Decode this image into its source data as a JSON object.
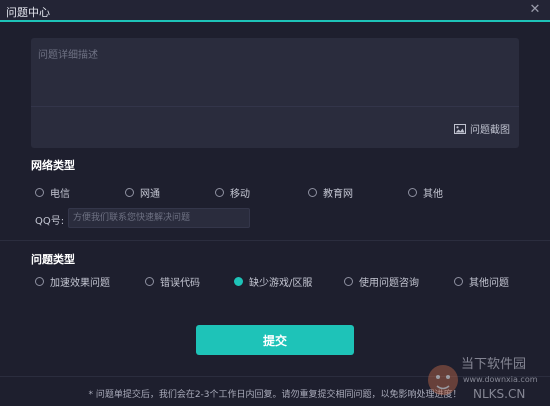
{
  "window": {
    "title": "问题中心"
  },
  "description": {
    "placeholder": "问题详细描述",
    "screenshot_label": "问题截图"
  },
  "network": {
    "title": "网络类型",
    "options": [
      "电信",
      "网通",
      "移动",
      "教育网",
      "其他"
    ],
    "qq_label": "QQ号:",
    "qq_placeholder": "方便我们联系您快速解决问题"
  },
  "issue": {
    "title": "问题类型",
    "options": [
      "加速效果问题",
      "错误代码",
      "缺少游戏/区服",
      "使用问题咨询",
      "其他问题"
    ],
    "selected": "缺少游戏/区服"
  },
  "submit_label": "提交",
  "footnote": "* 问题单提交后，我们会在2-3个工作日内回复。请勿重复提交相同问题，以免影响处理进度！",
  "watermark": {
    "line1": "当下软件园",
    "line2": "www.downxia.com",
    "line3": "NLKS.CN"
  },
  "colors": {
    "accent": "#1ec3b8",
    "background": "#1e1f2e",
    "panel": "#2a2c3d"
  }
}
